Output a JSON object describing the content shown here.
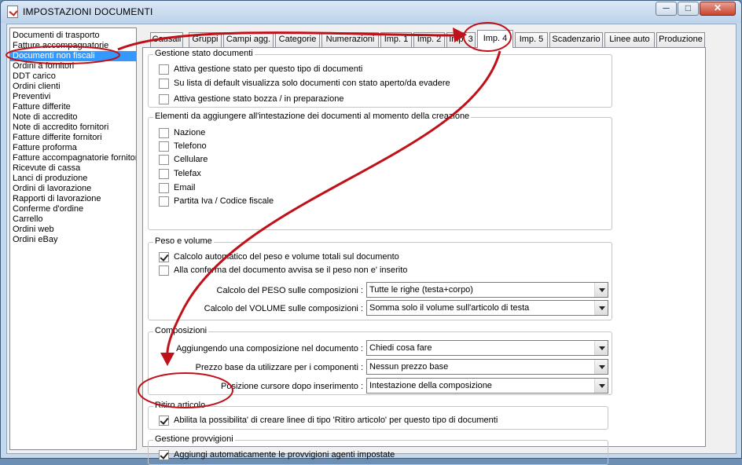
{
  "window": {
    "title": "IMPOSTAZIONI DOCUMENTI",
    "min": "─",
    "max": "□",
    "close": "✕"
  },
  "doc_types": [
    "Documenti di trasporto",
    "Fatture accompagnatorie",
    "Documenti non fiscali",
    "Ordini a fornitori",
    "DDT carico",
    "Ordini clienti",
    "Preventivi",
    "Fatture differite",
    "Note di accredito",
    "Note di accredito fornitori",
    "Fatture differite fornitori",
    "Fatture proforma",
    "Fatture accompagnatorie fornitori",
    "Ricevute di cassa",
    "Lanci di produzione",
    "Ordini di lavorazione",
    "Rapporti di lavorazione",
    "Conferme d'ordine",
    "Carrello",
    "Ordini web",
    "Ordini eBay"
  ],
  "selected_doc": "Documenti non fiscali",
  "tabs": [
    "Causali",
    "Gruppi",
    "Campi agg.",
    "Categorie",
    "Numerazioni",
    "Imp. 1",
    "Imp. 2",
    "Imp. 3",
    "Imp. 4",
    "Imp. 5",
    "Scadenzario",
    "Linee auto",
    "Produzione"
  ],
  "active_tab": "Imp. 4",
  "stato": {
    "title": "Gestione stato documenti",
    "items": [
      {
        "label": "Attiva gestione stato per questo tipo di documenti",
        "checked": false
      },
      {
        "label": "Su lista di default visualizza solo documenti con stato aperto/da evadere",
        "checked": false
      },
      {
        "label": "Attiva gestione stato bozza / in preparazione",
        "checked": false
      }
    ]
  },
  "intestazione": {
    "title": "Elementi da aggiungere all'intestazione dei documenti al momento della creazione",
    "items": [
      {
        "label": "Nazione",
        "checked": false
      },
      {
        "label": "Telefono",
        "checked": false
      },
      {
        "label": "Cellulare",
        "checked": false
      },
      {
        "label": "Telefax",
        "checked": false
      },
      {
        "label": "Email",
        "checked": false
      },
      {
        "label": "Partita Iva / Codice fiscale",
        "checked": false
      }
    ]
  },
  "peso": {
    "title": "Peso e volume",
    "items": [
      {
        "label": "Calcolo automatico del peso e volume totali sul documento",
        "checked": true
      },
      {
        "label": "Alla conferma del documento avvisa se il peso non e' inserito",
        "checked": false
      }
    ],
    "peso_label": "Calcolo del PESO sulle composizioni :",
    "peso_value": "Tutte le righe (testa+corpo)",
    "volume_label": "Calcolo del VOLUME sulle composizioni :",
    "volume_value": "Somma solo il volume sull'articolo di testa"
  },
  "composizioni": {
    "title": "Composizioni",
    "rows": [
      {
        "label": "Aggiungendo una composizione nel documento :",
        "value": "Chiedi cosa fare"
      },
      {
        "label": "Prezzo base da utilizzare per i componenti :",
        "value": "Nessun prezzo base"
      },
      {
        "label": "Posizione cursore dopo inserimento :",
        "value": "Intestazione della composizione"
      }
    ]
  },
  "ritiro": {
    "title": "Ritiro articolo",
    "label": "Abilita la possibilita' di creare linee di tipo 'Ritiro articolo' per questo tipo di documenti",
    "checked": true
  },
  "provvigioni": {
    "title": "Gestione provvigioni",
    "label": "Aggiungi automaticamente le provvigioni agenti impostate",
    "checked": true
  },
  "annotation_color": "#c0111b"
}
